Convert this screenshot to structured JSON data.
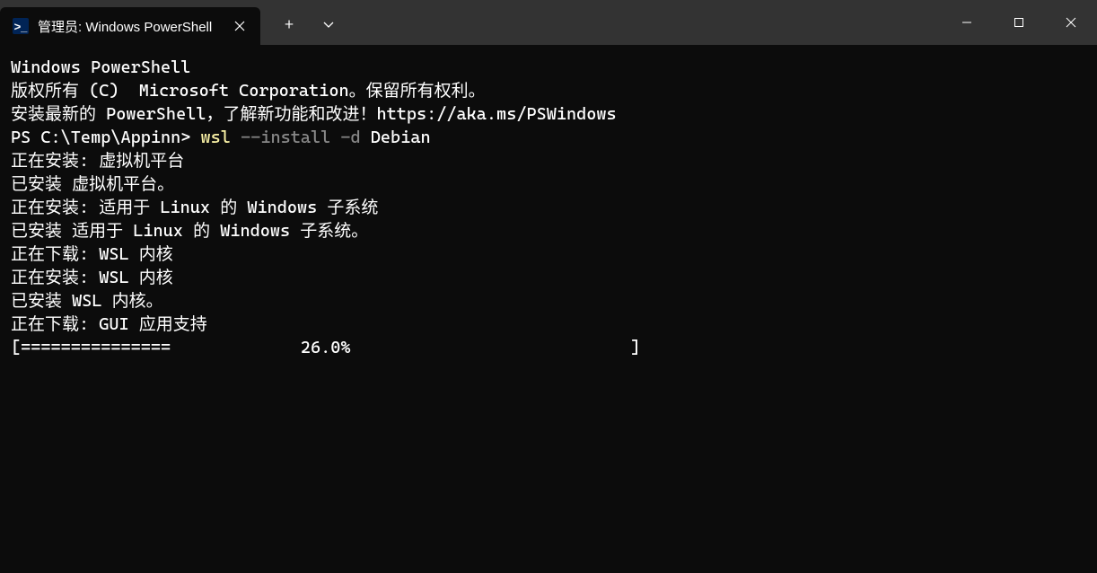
{
  "tab": {
    "title": "管理员: Windows PowerShell",
    "icon_glyph": ">_"
  },
  "terminal": {
    "header_line1": "Windows PowerShell",
    "header_line2": "版权所有 (C)  Microsoft Corporation。保留所有权利。",
    "blank1": "",
    "install_hint": "安装最新的 PowerShell，了解新功能和改进！https://aka.ms/PSWindows",
    "blank2": "",
    "prompt_prefix": "PS C:\\Temp\\Appinn> ",
    "cmd_part1": "wsl ",
    "cmd_part2": "--install -d",
    "cmd_part3": " Debian",
    "out_line1": "正在安装: 虚拟机平台",
    "out_line2": "已安装 虚拟机平台。",
    "out_line3": "正在安装: 适用于 Linux 的 Windows 子系统",
    "out_line4": "已安装 适用于 Linux 的 Windows 子系统。",
    "out_line5": "正在下载: WSL 内核",
    "out_line6": "正在安装: WSL 内核",
    "out_line7": "已安装 WSL 内核。",
    "out_line8": "正在下载: GUI 应用支持",
    "progress_line": "[===============             26.0%                            ]"
  }
}
